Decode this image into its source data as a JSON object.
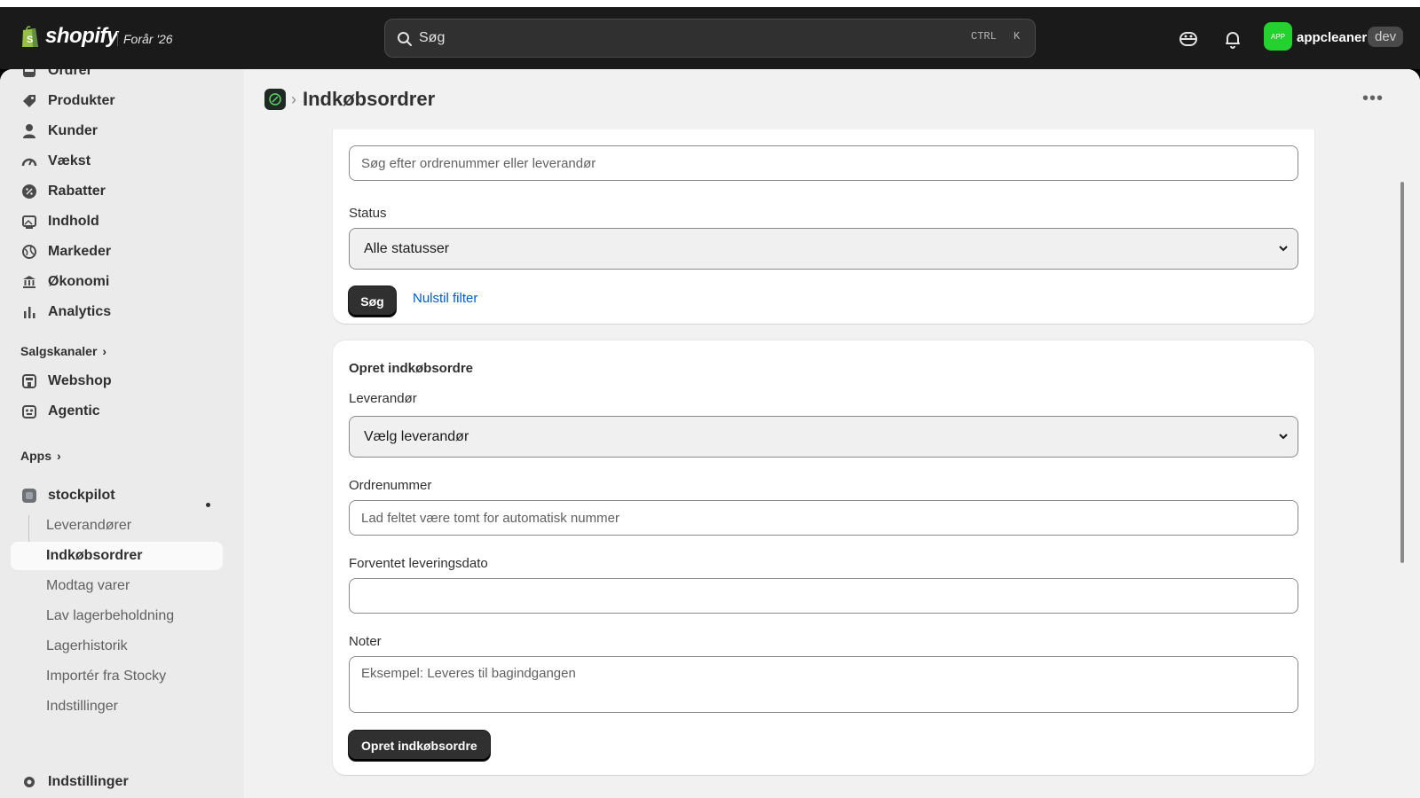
{
  "topbar": {
    "brand": "shopify",
    "edition": "Forår '26",
    "search_placeholder": "Søg",
    "shortcut_ctrl": "CTRL",
    "shortcut_k": "K",
    "avatar_text": "APP",
    "store_name": "appcleaner",
    "env_badge": "dev"
  },
  "sidebar": {
    "main_items": [
      {
        "label": "Ordrer",
        "icon": "inbox-icon"
      },
      {
        "label": "Produkter",
        "icon": "tag-icon"
      },
      {
        "label": "Kunder",
        "icon": "person-icon"
      },
      {
        "label": "Vækst",
        "icon": "gauge-icon"
      },
      {
        "label": "Rabatter",
        "icon": "discount-icon"
      },
      {
        "label": "Indhold",
        "icon": "image-icon"
      },
      {
        "label": "Markeder",
        "icon": "globe-icon"
      },
      {
        "label": "Økonomi",
        "icon": "bank-icon"
      },
      {
        "label": "Analytics",
        "icon": "bar-chart-icon"
      }
    ],
    "sales_channels_title": "Salgskanaler",
    "sales_channels": [
      {
        "label": "Webshop",
        "icon": "store-icon"
      },
      {
        "label": "Agentic",
        "icon": "robot-icon"
      }
    ],
    "apps_title": "Apps",
    "app_name": "stockpilot",
    "app_items": [
      "Leverandører",
      "Indkøbsordrer",
      "Modtag varer",
      "Lav lagerbeholdning",
      "Lagerhistorik",
      "Importér fra Stocky",
      "Indstillinger"
    ],
    "settings_label": "Indstillinger"
  },
  "page": {
    "title": "Indkøbsordrer",
    "filter": {
      "search_placeholder": "Søg efter ordrenummer eller leverandør",
      "status_label": "Status",
      "status_value": "Alle statusser",
      "search_button": "Søg",
      "reset_link": "Nulstil filter"
    },
    "create": {
      "title": "Opret indkøbsordre",
      "supplier_label": "Leverandør",
      "supplier_value": "Vælg leverandør",
      "order_number_label": "Ordrenummer",
      "order_number_placeholder": "Lad feltet være tomt for automatisk nummer",
      "delivery_date_label": "Forventet leveringsdato",
      "delivery_date_value": "",
      "notes_label": "Noter",
      "notes_placeholder": "Eksempel: Leveres til bagindgangen",
      "submit_button": "Opret indkøbsordre"
    }
  },
  "colors": {
    "topbar": "#1a1a1a",
    "accent_link": "#005bd3",
    "primary_button": "#303030",
    "avatar": "#23d12f"
  }
}
